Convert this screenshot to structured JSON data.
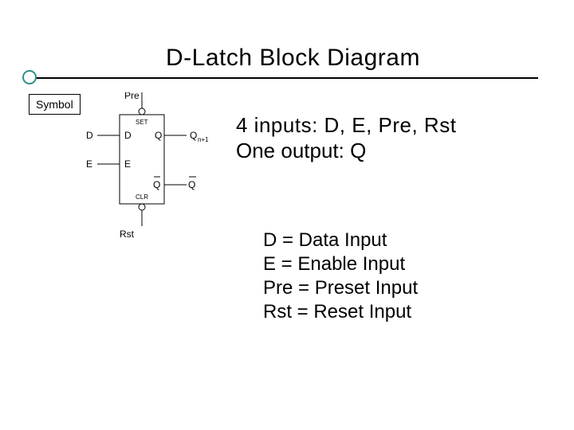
{
  "title": "D-Latch Block Diagram",
  "symbol_label": "Symbol",
  "schematic": {
    "pins": {
      "pre": "Pre",
      "d_outer": "D",
      "e_outer": "E",
      "rst": "Rst",
      "d_inner": "D",
      "e_inner": "E",
      "set": "SET",
      "clr": "CLR",
      "q": "Q",
      "q_sub": "n+1",
      "qbar": "Q"
    }
  },
  "summary": {
    "line1": "4 inputs: D, E, Pre, Rst",
    "line2": "One output: Q"
  },
  "definitions": {
    "d": "D = Data Input",
    "e": "E = Enable Input",
    "pre": "Pre = Preset Input",
    "rst": "Rst = Reset Input"
  }
}
